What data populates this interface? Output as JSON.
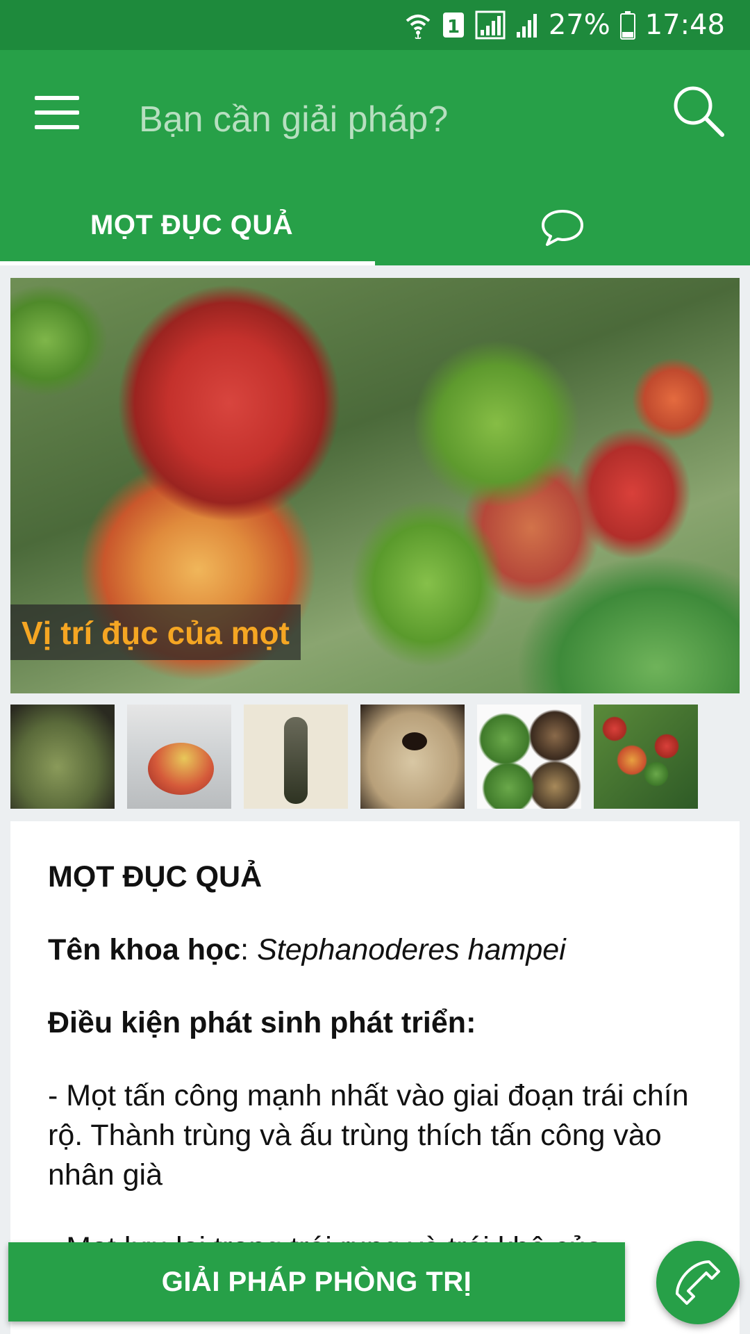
{
  "status_bar": {
    "sim_number": "1",
    "battery": "27%",
    "time": "17:48"
  },
  "search": {
    "placeholder": "Bạn cần giải pháp?"
  },
  "tabs": [
    {
      "label": "MỌT ĐỤC QUẢ",
      "active": true
    },
    {
      "icon": "chat-bubble-icon",
      "active": false
    }
  ],
  "gallery": {
    "caption": "Vị trí đục của mọt",
    "thumbnail_count": 6
  },
  "article": {
    "title": "MỌT ĐỤC QUẢ",
    "scientific_label": "Tên khoa học",
    "scientific_sep": ": ",
    "scientific_name": "Stephanoderes hampei",
    "conditions_heading": "Điều kiện phát sinh phát triển:",
    "paragraph_1": "- Mọt tấn công mạnh nhất vào giai đoạn trái chín rộ. Thành trùng và ấu trùng thích tấn công vào nhân già",
    "paragraph_2_partial": "- Mọt lưu lại trong trái rụng và trái khô của"
  },
  "actions": {
    "cta_label": "GIẢI PHÁP PHÒNG TRỊ",
    "call_icon": "phone-icon"
  },
  "colors": {
    "status_bar": "#1e8a3c",
    "primary": "#27a048",
    "caption_text": "#f5a623",
    "background": "#eceff1"
  }
}
